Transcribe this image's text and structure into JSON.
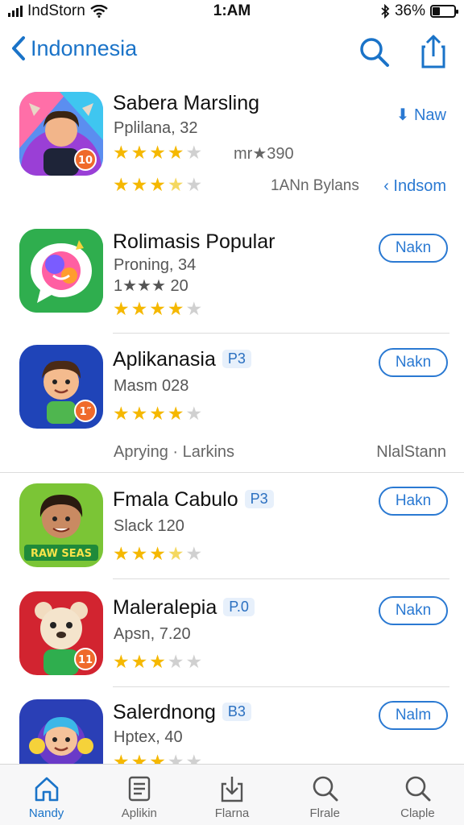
{
  "status_bar": {
    "carrier": "IndStorn",
    "time": "1:AM",
    "battery": "36%",
    "battery_level": 0.36
  },
  "nav": {
    "back_title": "Indonnesia"
  },
  "apps": [
    {
      "name": "Sabera Marsling",
      "badge": "",
      "subtitle": "Pplilana, 32",
      "rating_line": "mr★390",
      "rating": 4,
      "button": "",
      "link": "⬇ Naw",
      "meta_left": "1ANn Bylans",
      "link2": "‹ Indsom",
      "rating2": 3.5
    },
    {
      "name": "Rolimasis Popular",
      "badge": "",
      "subtitle": "Proning, 34",
      "rating_line": "1★★★ 20",
      "rating": 4,
      "button": "Nakn"
    },
    {
      "name": "Aplikanasia",
      "badge": "P3",
      "subtitle": "Masm 028",
      "rating": 4,
      "button": "Nakn",
      "meta_left": "Aprying · Larkins",
      "meta_right": "NlalStann"
    },
    {
      "name": "Fmala Cabulo",
      "badge": "P3",
      "subtitle": "Slack 120",
      "rating": 3.5,
      "button": "Hakn"
    },
    {
      "name": "Maleralepia",
      "badge": "P.0",
      "subtitle": "Apsn, 7.20",
      "rating": 3,
      "button": "Nakn"
    },
    {
      "name": "Salerdnong",
      "badge": "B3",
      "subtitle": "Hptex, 40",
      "rating": 3,
      "button": "Nalm"
    }
  ],
  "icon_badges": [
    "10",
    "1″",
    "11"
  ],
  "icon_banner": "RAW SEAS",
  "tabs": [
    {
      "label": "Nandy",
      "icon": "home-icon",
      "active": true
    },
    {
      "label": "Aplikin",
      "icon": "apps-icon",
      "active": false
    },
    {
      "label": "Flarna",
      "icon": "download-icon",
      "active": false
    },
    {
      "label": "Flrale",
      "icon": "search-icon",
      "active": false
    },
    {
      "label": "Claple",
      "icon": "search-icon",
      "active": false
    }
  ],
  "colors": {
    "accent": "#1a73c8",
    "star": "#f5b800"
  }
}
